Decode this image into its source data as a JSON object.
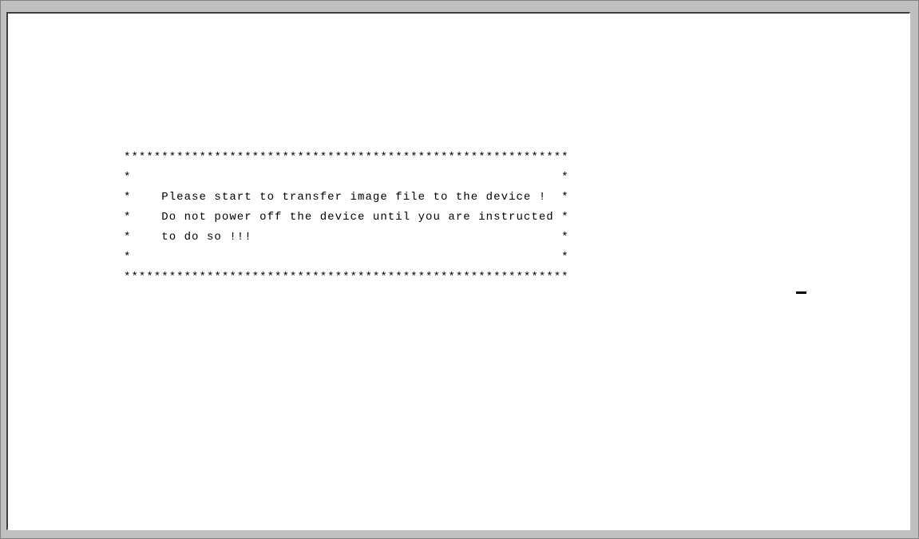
{
  "terminal": {
    "lines": [
      "***********************************************************",
      "*                                                         *",
      "*    Please start to transfer image file to the device !  *",
      "*    Do not power off the device until you are instructed *",
      "*    to do so !!!                                         *",
      "*                                                         *",
      "***********************************************************"
    ]
  },
  "colors": {
    "background": "#ffffff",
    "text": "#000000",
    "frame": "#c0c0c0"
  }
}
